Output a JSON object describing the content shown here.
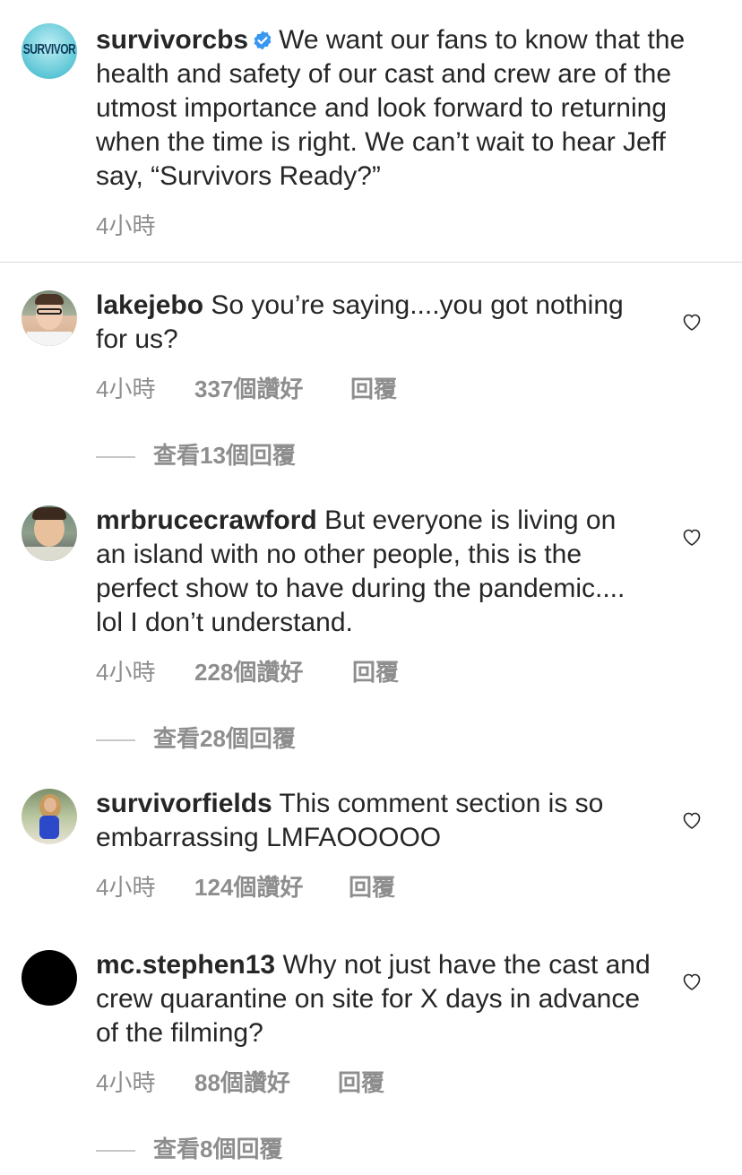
{
  "post": {
    "username": "survivorcbs",
    "caption": "We want our fans to know that the health and safety of our cast and crew are of the utmost importance and look forward to returning when the time is right. We can’t wait to hear Jeff say, “Survivors Ready?”",
    "time": "4小時",
    "avatar_text": "SURVIVOR"
  },
  "comments": [
    {
      "username": "lakejebo",
      "text": "So you’re saying....you got nothing for us?",
      "time": "4小時",
      "likes": "337個讚好",
      "reply": "回覆",
      "view_replies": "查看13個回覆"
    },
    {
      "username": "mrbrucecrawford",
      "text": "But everyone is living on an island with no other people, this is the perfect show to have during the pandemic.... lol I don’t understand.",
      "time": "4小時",
      "likes": "228個讚好",
      "reply": "回覆",
      "view_replies": "查看28個回覆"
    },
    {
      "username": "survivorfields",
      "text": "This comment section is so embarrassing LMFAOOOOO",
      "time": "4小時",
      "likes": "124個讚好",
      "reply": "回覆",
      "view_replies": ""
    },
    {
      "username": "mc.stephen13",
      "text": "Why not just have the cast and crew quarantine on site for X days in advance of the filming?",
      "time": "4小時",
      "likes": "88個讚好",
      "reply": "回覆",
      "view_replies": "查看8個回覆"
    }
  ],
  "colors": {
    "verified": "#3897f0",
    "meta": "#8e8e8e",
    "text": "#262626"
  }
}
